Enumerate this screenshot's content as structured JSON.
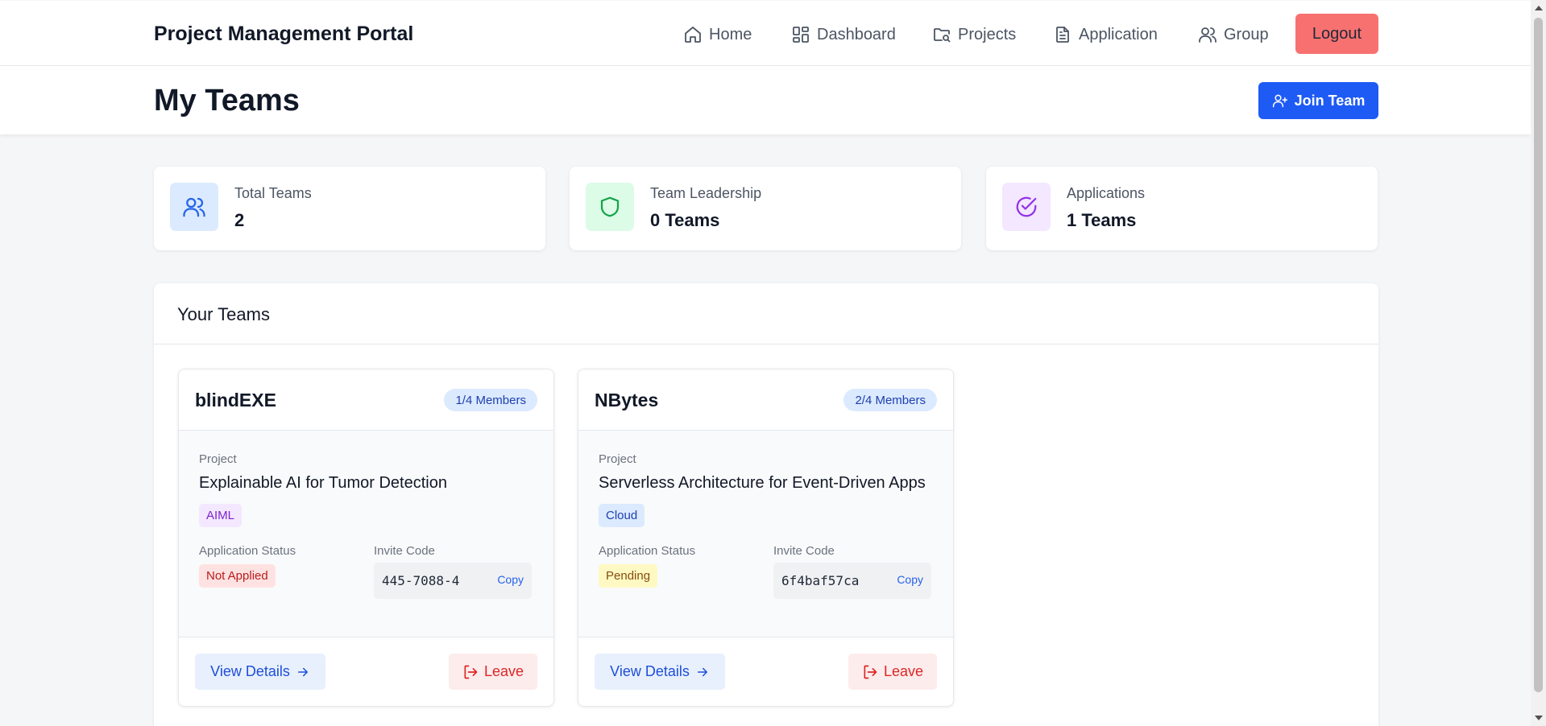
{
  "nav": {
    "brand": "Project Management Portal",
    "links": [
      {
        "label": "Home",
        "icon": "home-icon"
      },
      {
        "label": "Dashboard",
        "icon": "dashboard-icon"
      },
      {
        "label": "Projects",
        "icon": "projects-folder-icon"
      },
      {
        "label": "Application",
        "icon": "application-document-icon"
      },
      {
        "label": "Group",
        "icon": "group-users-icon"
      }
    ],
    "logout_label": "Logout"
  },
  "header": {
    "title": "My Teams",
    "join_label": "Join Team"
  },
  "stats": [
    {
      "label": "Total Teams",
      "value": "2",
      "icon": "users-icon",
      "icon_color": "#2563eb",
      "icon_bg": "#dbeafe"
    },
    {
      "label": "Team Leadership",
      "value": "0 Teams",
      "icon": "shield-icon",
      "icon_color": "#16a34a",
      "icon_bg": "#dcfce7"
    },
    {
      "label": "Applications",
      "value": "1 Teams",
      "icon": "check-circle-icon",
      "icon_color": "#9333ea",
      "icon_bg": "#f3e8ff"
    }
  ],
  "panel": {
    "title": "Your Teams"
  },
  "teams": [
    {
      "name": "blindEXE",
      "members": "1/4 Members",
      "project_label": "Project",
      "project_title": "Explainable AI for Tumor Detection",
      "tag": "AIML",
      "tag_bg": "#f3e8ff",
      "tag_color": "#7e22ce",
      "status_label": "Application Status",
      "status": "Not Applied",
      "status_bg": "#fee2e2",
      "status_color": "#b91c1c",
      "invite_label": "Invite Code",
      "invite_code": "445-7088-4",
      "copy_label": "Copy",
      "view_label": "View Details",
      "leave_label": "Leave"
    },
    {
      "name": "NBytes",
      "members": "2/4 Members",
      "project_label": "Project",
      "project_title": "Serverless Architecture for Event-Driven Apps",
      "tag": "Cloud",
      "tag_bg": "#dbeafe",
      "tag_color": "#1e40af",
      "status_label": "Application Status",
      "status": "Pending",
      "status_bg": "#fef9c3",
      "status_color": "#854d0e",
      "invite_label": "Invite Code",
      "invite_code": "6f4baf57ca",
      "copy_label": "Copy",
      "view_label": "View Details",
      "leave_label": "Leave"
    }
  ],
  "colors": {
    "primary": "#1e5bf5",
    "logout": "#f87171",
    "page_bg": "#f5f6f8"
  }
}
